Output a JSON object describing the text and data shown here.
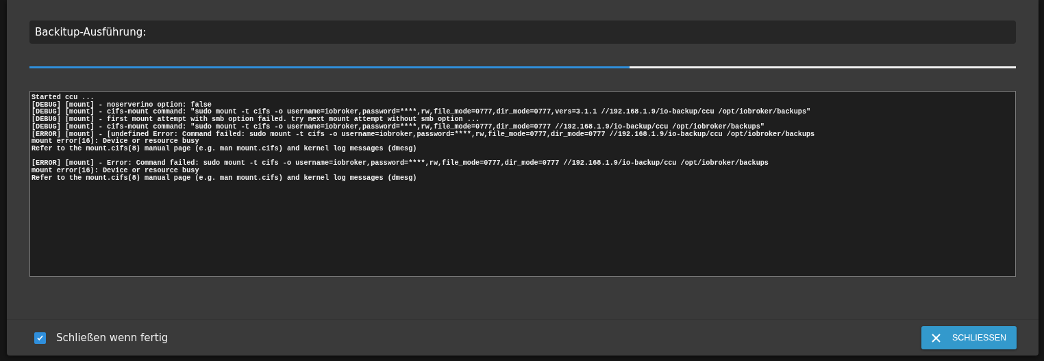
{
  "dialog": {
    "title": "Backitup-Ausführung:",
    "progress": {
      "level": 0.608
    },
    "log": [
      [
        "Started ccu ...",
        "[DEBUG] [mount] - noserverino option: false",
        "[DEBUG] [mount] - cifs-mount command: \"sudo mount -t cifs -o username=iobroker,password=****,rw,file_mode=0777,dir_mode=0777,vers=3.1.1 //192.168.1.9/io-backup/ccu /opt/iobroker/backups\"",
        "[DEBUG] [mount] - first mount attempt with smb option failed. try next mount attempt without smb option ...",
        "[DEBUG] [mount] - cifs-mount command: \"sudo mount -t cifs -o username=iobroker,password=****,rw,file_mode=0777,dir_mode=0777 //192.168.1.9/io-backup/ccu /opt/iobroker/backups\"",
        "[ERROR] [mount] - [undefined Error: Command failed: sudo mount -t cifs -o username=iobroker,password=****,rw,file_mode=0777,dir_mode=0777 //192.168.1.9/io-backup/ccu /opt/iobroker/backups",
        "mount error(16): Device or resource busy",
        "Refer to the mount.cifs(8) manual page (e.g. man mount.cifs) and kernel log messages (dmesg)"
      ],
      [
        "[ERROR] [mount] - Error: Command failed: sudo mount -t cifs -o username=iobroker,password=****,rw,file_mode=0777,dir_mode=0777 //192.168.1.9/io-backup/ccu /opt/iobroker/backups",
        "mount error(16): Device or resource busy",
        "Refer to the mount.cifs(8) manual page (e.g. man mount.cifs) and kernel log messages (dmesg)"
      ]
    ],
    "close_when_done": {
      "label": "Schließen wenn fertig",
      "checked": true
    },
    "close_button": {
      "label": "SCHLIESSEN"
    }
  }
}
